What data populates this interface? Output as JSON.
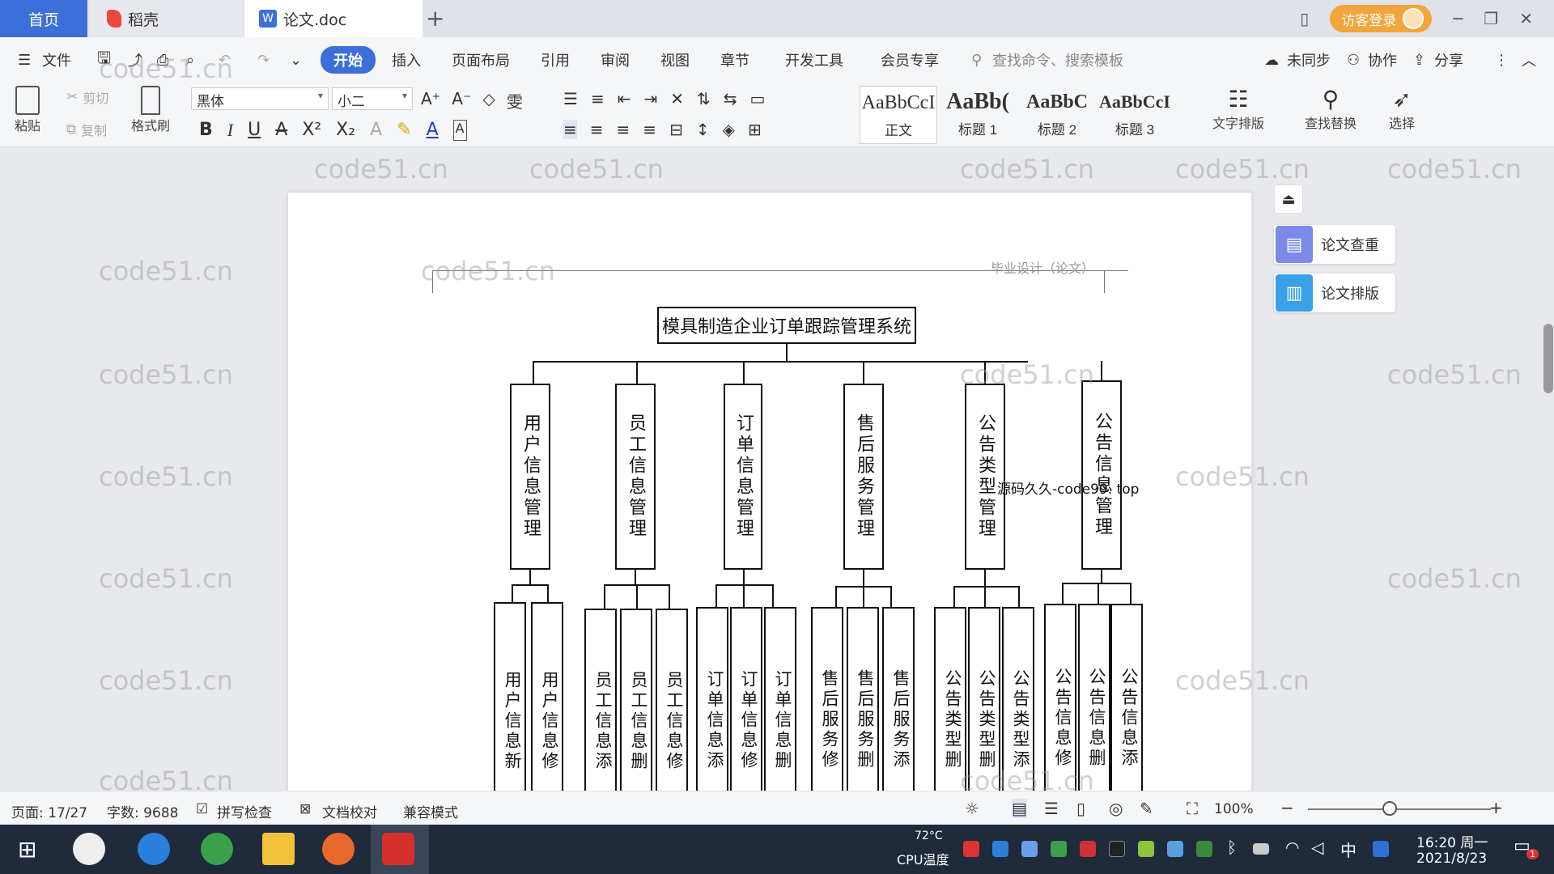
{
  "tabs": {
    "home": "首页",
    "daoke": "稻壳",
    "doc": "论文.doc",
    "doc_icon": "W",
    "add": "+"
  },
  "window": {
    "login": "访客登录",
    "minimize": "─",
    "restore": "❐",
    "close": "✕",
    "layout": "▯"
  },
  "menu": {
    "file": "文件",
    "items": [
      "开始",
      "插入",
      "页面布局",
      "引用",
      "审阅",
      "视图",
      "章节",
      "开发工具",
      "会员专享"
    ],
    "search": "查找命令、搜索模板",
    "unsynced": "未同步",
    "collab": "协作",
    "share": "分享"
  },
  "ribbon": {
    "paste": "粘贴",
    "cut": "剪切",
    "copy": "复制",
    "format_painter": "格式刷",
    "font": "黑体",
    "size": "小二",
    "styles": [
      {
        "sample": "AaBbCcI",
        "label": "正文"
      },
      {
        "sample": "AaBb(",
        "label": "标题 1"
      },
      {
        "sample": "AaBbC",
        "label": "标题 2"
      },
      {
        "sample": "AaBbCcI",
        "label": "标题 3"
      }
    ],
    "text_layout": "文字排版",
    "find_replace": "查找替换",
    "select": "选择"
  },
  "document": {
    "header": "毕业设计（论文）",
    "overlay_text": "源码久久-code99. top",
    "root": "模具制造企业订单跟踪管理系统",
    "modules": [
      {
        "name": "用户信息管理",
        "children": [
          "用户信息新",
          "用户信息修"
        ]
      },
      {
        "name": "员工信息管理",
        "children": [
          "员工信息添",
          "员工信息删",
          "员工信息修"
        ]
      },
      {
        "name": "订单信息管理",
        "children": [
          "订单信息添",
          "订单信息修",
          "订单信息删"
        ]
      },
      {
        "name": "售后服务管理",
        "children": [
          "售后服务修",
          "售后服务删",
          "售后服务添"
        ]
      },
      {
        "name": "公告类型管理",
        "children": [
          "公告类型删",
          "公告类型删",
          "公告类型添"
        ]
      },
      {
        "name": "公告信息管理",
        "children": [
          "公告信息修",
          "公告信息删",
          "公告信息添"
        ]
      }
    ],
    "watermark": "code51.cn"
  },
  "side": {
    "check": "论文查重",
    "layout": "论文排版"
  },
  "status": {
    "page": "页面: 17/27",
    "words": "字数: 9688",
    "spell": "拼写检查",
    "proof": "文档校对",
    "compat": "兼容模式",
    "zoom": "100%"
  },
  "taskbar": {
    "temp": "72°C",
    "cpu": "CPU温度",
    "time": "16:20 周一",
    "date": "2021/8/23",
    "ime": "中",
    "notify_count": "1"
  }
}
